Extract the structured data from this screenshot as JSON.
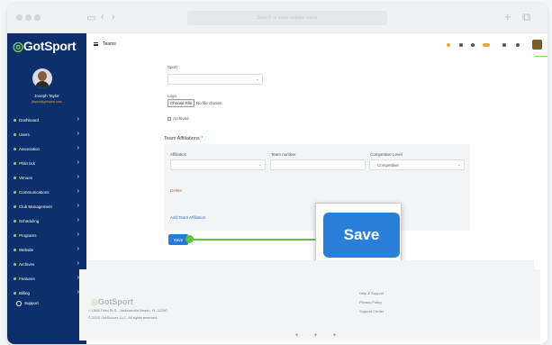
{
  "browser": {
    "url_text": "Search or enter website name"
  },
  "sidebar": {
    "logo": "GotSport",
    "user_name": "Joseph Taylor",
    "user_email": "jtaylor@gotsport.com",
    "items": [
      {
        "label": "Dashboard"
      },
      {
        "label": "Users"
      },
      {
        "label": "Association"
      },
      {
        "label": "Phlin tick"
      },
      {
        "label": "Venues"
      },
      {
        "label": "Communications"
      },
      {
        "label": "Club Management"
      },
      {
        "label": "Scheduling"
      },
      {
        "label": "Programs"
      },
      {
        "label": "Website"
      },
      {
        "label": "Archives"
      },
      {
        "label": "Features"
      },
      {
        "label": "Billing"
      }
    ],
    "support_label": "Support"
  },
  "header": {
    "title": "Teams"
  },
  "form": {
    "sport_label": "Sport",
    "logo_label": "Logo",
    "choose_file_label": "Choose File",
    "no_file_text": "No file chosen",
    "archived_label": "Archived",
    "affiliations_title": "Team Affiliations",
    "affiliation_label": "Affiliation",
    "team_number_label": "Team number",
    "competitive_level_label": "Competitive Level",
    "competitive_level_value": "Competitive",
    "delete_label": "Delete",
    "add_affiliation_label": "Add Team Affiliation",
    "save_label": "Save"
  },
  "zoom_callout": {
    "save_label": "Save"
  },
  "footer": {
    "logo": "GotSport",
    "address": "1505 Third St S., Jacksonville Beach, FL 32250",
    "copyright": "© 2022 GotSoccer, LLC. All rights reserved.",
    "links": [
      "Help & Support",
      "Privacy Policy",
      "Support Center"
    ]
  },
  "colors": {
    "sidebar_bg": "#0d2f6c",
    "accent_green": "#7bd15a",
    "primary_blue": "#2a80d9",
    "delete_red": "#e0564b"
  }
}
